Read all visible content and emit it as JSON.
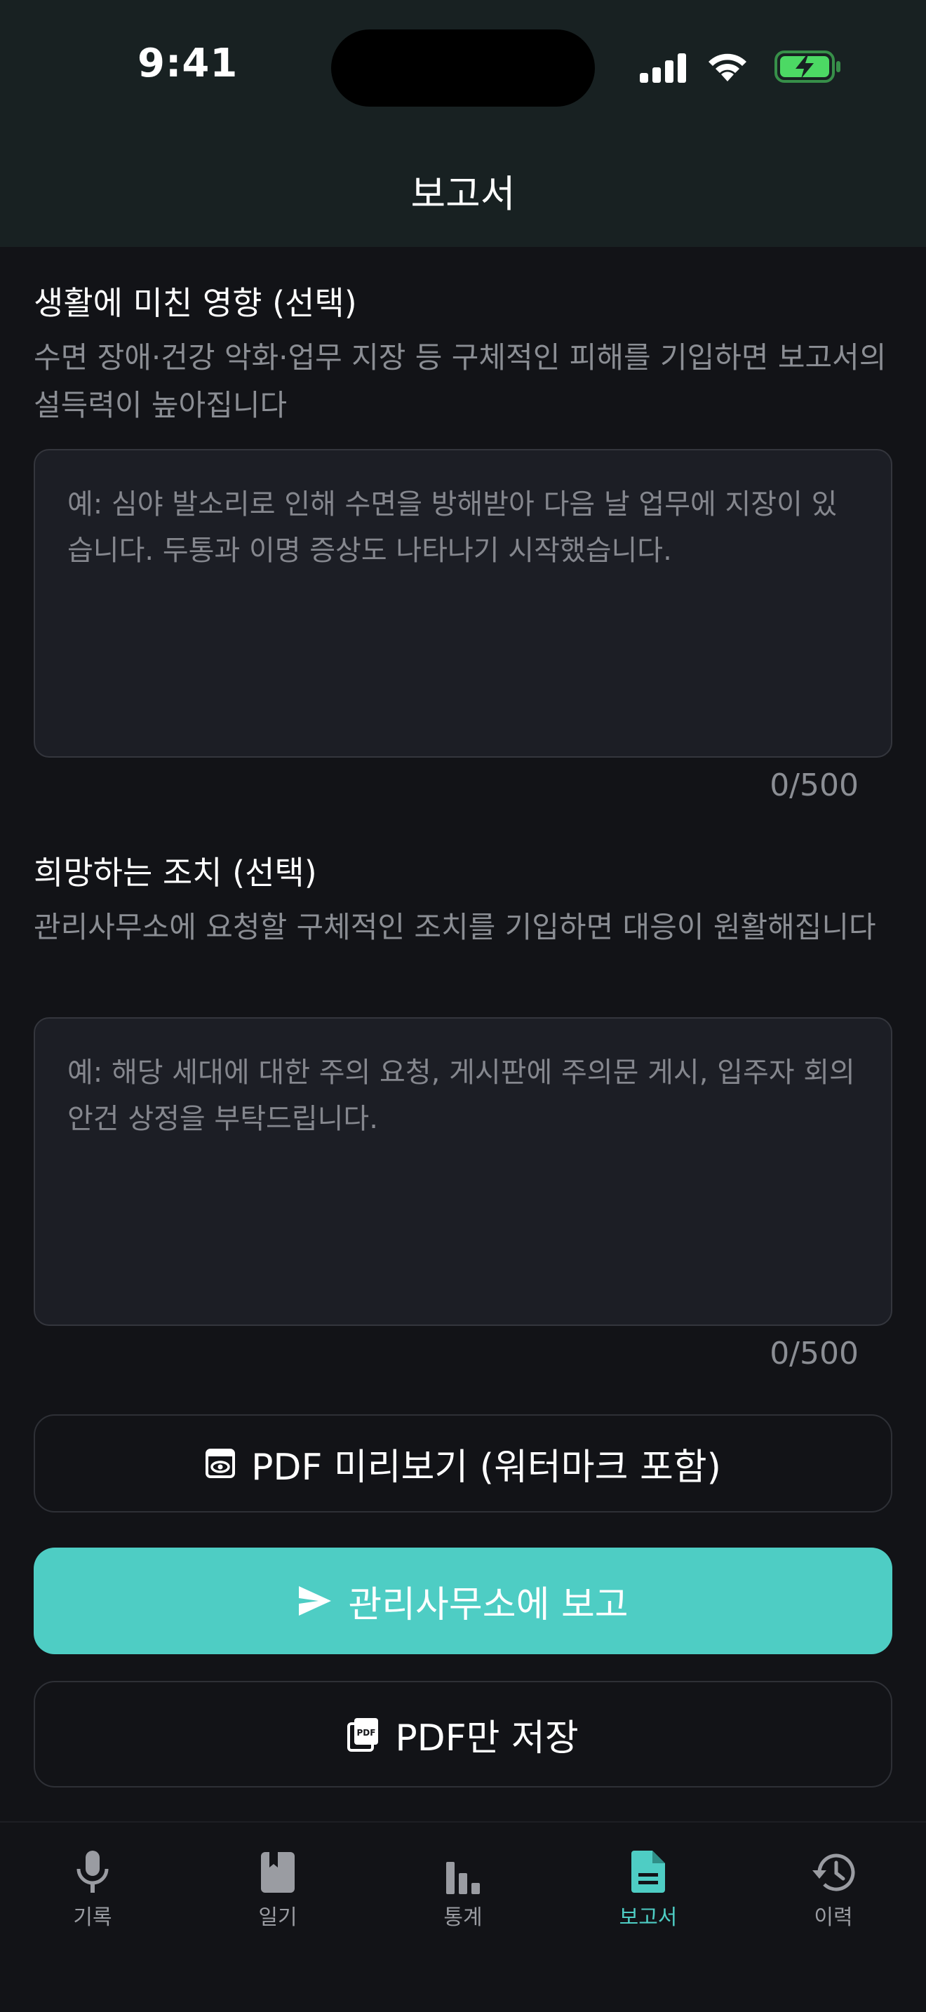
{
  "status_bar": {
    "time": "9:41"
  },
  "header": {
    "title": "보고서"
  },
  "impact": {
    "title": "생활에 미친 영향 (선택)",
    "description": "수면 장애·건강 악화·업무 지장 등 구체적인 피해를 기입하면 보고서의 설득력이 높아집니다",
    "placeholder": "예: 심야 발소리로 인해 수면을 방해받아 다음 날 업무에 지장이 있습니다. 두통과 이명 증상도 나타나기 시작했습니다.",
    "value": "",
    "counter": "0/500"
  },
  "request": {
    "title": "희망하는 조치 (선택)",
    "description": "관리사무소에 요청할 구체적인 조치를 기입하면 대응이 원활해집니다",
    "placeholder": "예: 해당 세대에 대한 주의 요청, 게시판에 주의문 게시, 입주자 회의 안건 상정을 부탁드립니다.",
    "value": "",
    "counter": "0/500"
  },
  "actions": {
    "preview_label": "PDF 미리보기 (워터마크 포함)",
    "report_label": "관리사무소에 보고",
    "save_pdf_label": "PDF만 저장"
  },
  "tabs": [
    {
      "label": "기록",
      "icon": "mic-icon",
      "active": false
    },
    {
      "label": "일기",
      "icon": "bookmark-book-icon",
      "active": false
    },
    {
      "label": "통계",
      "icon": "bar-chart-icon",
      "active": false
    },
    {
      "label": "보고서",
      "icon": "document-icon",
      "active": true
    },
    {
      "label": "이력",
      "icon": "history-icon",
      "active": false
    }
  ],
  "colors": {
    "accent": "#4ecdc4",
    "background": "#121317",
    "header_bg": "#182122",
    "field_bg": "#1c1e25",
    "battery_green": "#4cd964"
  }
}
